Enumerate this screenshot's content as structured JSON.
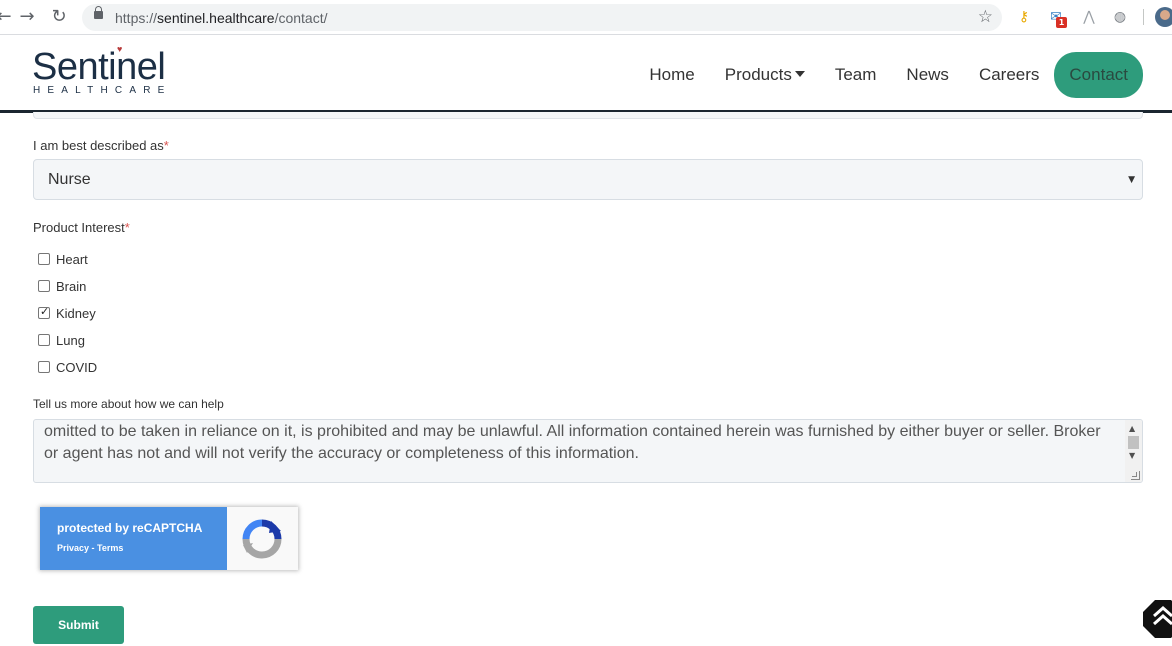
{
  "browser": {
    "url_scheme": "https://",
    "url_host": "sentinel.healthcare",
    "url_path": "/contact/",
    "notification_count": "1"
  },
  "header": {
    "logo_text": "Sentinel",
    "logo_subtext": "HEALTHCARE",
    "nav": {
      "home": "Home",
      "products": "Products",
      "team": "Team",
      "news": "News",
      "careers": "Careers",
      "contact": "Contact"
    }
  },
  "form": {
    "description_label": "I am best described as",
    "description_value": "Nurse",
    "required_mark": "*",
    "product_interest_label": "Product Interest",
    "products": [
      {
        "label": "Heart",
        "checked": false
      },
      {
        "label": "Brain",
        "checked": false
      },
      {
        "label": "Kidney",
        "checked": true
      },
      {
        "label": "Lung",
        "checked": false
      },
      {
        "label": "COVID",
        "checked": false
      }
    ],
    "help_label": "Tell us more about how we can help",
    "help_text": "omitted to be taken in reliance on it, is prohibited and may be unlawful.  All information contained herein was furnished by either buyer or seller.  Broker or agent has not and will not verify the accuracy or completeness of this information.",
    "recaptcha_title": "protected by reCAPTCHA",
    "recaptcha_links": "Privacy - Terms",
    "submit_label": "Submit"
  },
  "colors": {
    "accent": "#2e9c7c",
    "recaptcha_blue": "#4a90e2",
    "logo_navy": "#1c2f45"
  }
}
